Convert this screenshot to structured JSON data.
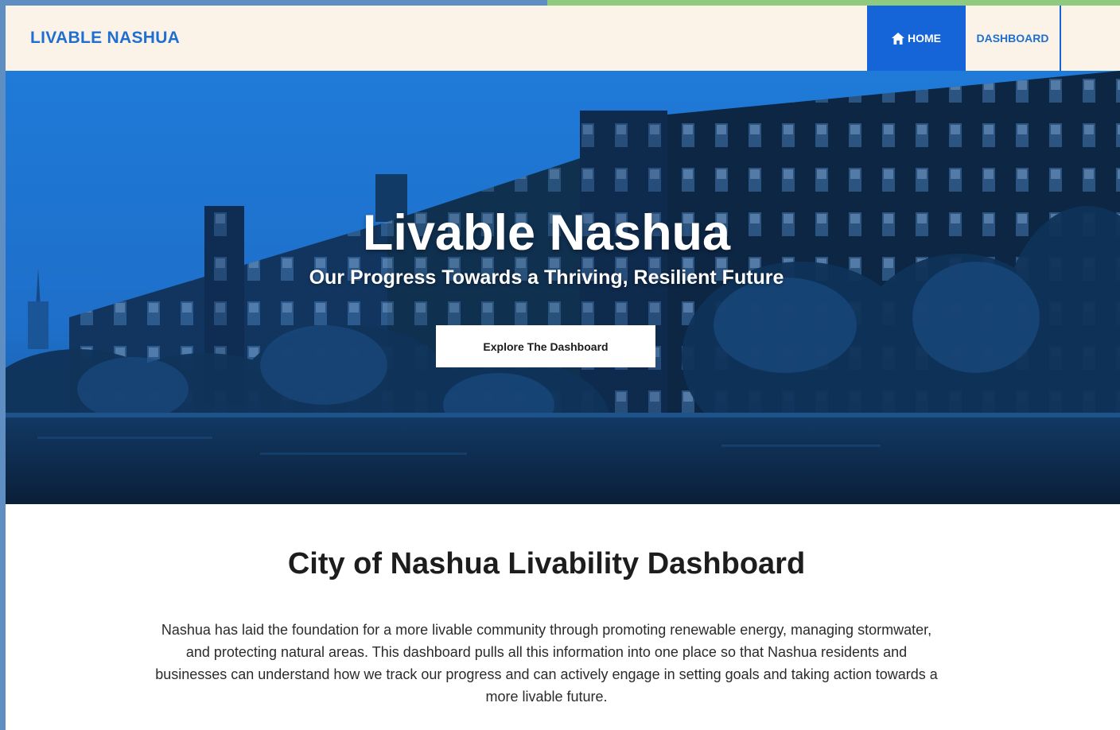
{
  "header": {
    "brand": "LIVABLE NASHUA",
    "nav": {
      "home_label": "HOME",
      "home_icon": "home-icon",
      "dashboard_label": "DASHBOARD"
    }
  },
  "hero": {
    "title": "Livable Nashua",
    "subtitle": "Our Progress Towards a Thriving, Resilient Future",
    "cta_label": "Explore The Dashboard"
  },
  "section": {
    "title": "City of Nashua Livability Dashboard",
    "body": "Nashua has laid the foundation for a more livable community through promoting renewable energy, managing stormwater, and protecting natural areas. This dashboard pulls all this information into one place so that Nashua residents and businesses can understand how we track our progress and can actively engage in setting goals and taking action towards a more livable future."
  },
  "colors": {
    "accent_blue": "#1565d8",
    "brand_blue": "#1f6fd0",
    "header_bg": "#fbf2e8",
    "accent_strip_left": "#5e8ec2",
    "accent_strip_right": "#8fcb7f"
  }
}
